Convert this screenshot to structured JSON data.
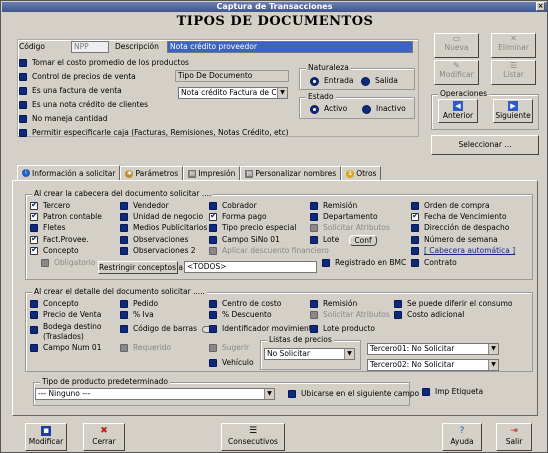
{
  "window": {
    "title": "Captura de Transacciones",
    "heading": "TIPOS DE DOCUMENTOS"
  },
  "header": {
    "codigo_label": "Código",
    "codigo_value": "NPP",
    "descripcion_label": "Descripción",
    "descripcion_value": "Nota crédito proveedor"
  },
  "options": [
    "Tomar el costo promedio de los productos",
    "Control de precios de venta",
    "Es una factura de venta",
    "Es una nota crédito de clientes",
    "No maneja cantidad",
    "Permitir especificarle caja  (Facturas, Remisiones, Notas Crédito, etc)"
  ],
  "tipo_doc": {
    "label": "Tipo De Documento",
    "value": "Nota crédito Factura de Cor"
  },
  "naturaleza": {
    "label": "Naturaleza",
    "entrada": "Entrada",
    "salida": "Salida"
  },
  "estado": {
    "label": "Estado",
    "activo": "Activo",
    "inactivo": "Inactivo"
  },
  "side_buttons": {
    "nueva": "Nueva",
    "eliminar": "Eliminar",
    "modificar": "Modificar",
    "listar": "Listar"
  },
  "operaciones": {
    "label": "Operaciones",
    "anterior": "Anterior",
    "siguiente": "Siguiente"
  },
  "seleccionar": "Seleccionar ...",
  "tabs": [
    "Información a solicitar",
    "Parámetros",
    "Impresión",
    "Personalizar nombres",
    "Otros"
  ],
  "cabecera": {
    "label": "Al crear la cabecera del documento solicitar ....",
    "col1": [
      "Tercero",
      "Patron contable",
      "Fletes",
      "Fact.Provee.",
      "Concepto"
    ],
    "col2": [
      "Vendedor",
      "Unidad de negocio",
      "Medios Publicitarios",
      "Observaciones",
      "Observaciones 2"
    ],
    "col3": [
      "Cobrador",
      "Forma pago",
      "Tipo precio especial",
      "Campo SiNo 01",
      "Aplicar descuento financiero"
    ],
    "col4": [
      "Remisión",
      "Departamento",
      "Solicitar Atributos",
      "Lote"
    ],
    "col5": [
      "Orden de compra",
      "Fecha de Vencimiento",
      "Dirección de despacho",
      "Número de semana",
      "[ Cabecera automática ]",
      "Contrato"
    ],
    "conf": "Conf",
    "obligatorio": "Obligatorio",
    "restringir": "Restringir conceptos a",
    "todos": "<TODOS>",
    "registrado": "Registrado en BMC"
  },
  "detalle": {
    "label": "Al crear  el detalle del documento solicitar .....",
    "col1": [
      "Concepto",
      "Precio de Venta",
      "Bodega destino (Traslados)",
      "Campo Num 01"
    ],
    "col2": [
      "Pedido",
      "% Iva",
      "Código de barras",
      "Requerido"
    ],
    "col3": [
      "Centro de costo",
      "% Descuento",
      "Identificador movimiento",
      "Sugerir",
      "Vehículo"
    ],
    "col4": [
      "Remisión",
      "Solicitar Atributos",
      "Lote producto"
    ],
    "col5": [
      "Se puede diferir el consumo",
      "Costo adicional"
    ],
    "listas_label": "Listas de precios",
    "listas_value": "No Solicitar",
    "tercero01": "Tercero01: No Solicitar",
    "tercero02": "Tercero02: No Solicitar"
  },
  "tipo_producto": {
    "label": "Tipo de producto predeterminado",
    "value": "--- Ninguno ---"
  },
  "ubicarse": "Ubicarse en el siguiente campo",
  "imp_etiqueta": "Imp Etiqueta",
  "bottom": {
    "modificar": "Modificar",
    "cerrar": "Cerrar",
    "consecutivos": "Consecutivos",
    "ayuda": "Ayuda",
    "salir": "Salir"
  }
}
